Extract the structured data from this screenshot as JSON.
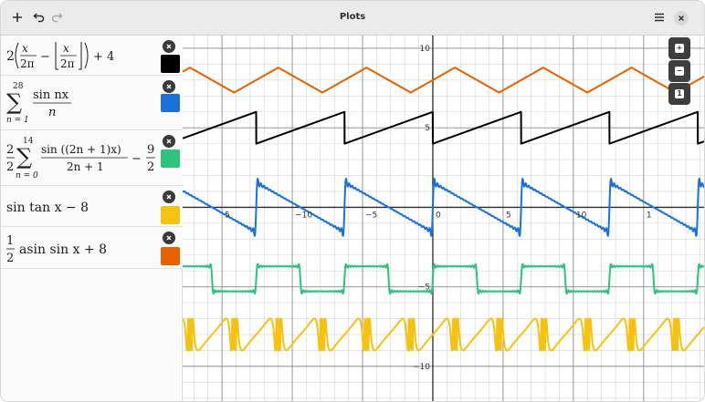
{
  "window": {
    "title": "Plots"
  },
  "header": {
    "left_icons": [
      "add-icon",
      "undo-icon",
      "redo-icon"
    ],
    "right_icons": [
      "menu-icon",
      "close-icon"
    ]
  },
  "equations": [
    {
      "latex": "2\\left(\\frac{x}{2\\pi}-\\left\\lfloor\\frac{x}{2\\pi}\\right\\rfloor\\right)+4",
      "color": "#000000"
    },
    {
      "latex": "\\sum_{n=1}^{28}\\frac{\\sin nx}{n}",
      "color": "#1c71d8"
    },
    {
      "latex": "\\frac{2}{2}\\sum_{n=0}^{14}\\frac{\\sin((2n+1)x)}{2n+1}-\\frac{9}{2}",
      "color": "#2ec27e"
    },
    {
      "latex": "\\sin\\tan x-8",
      "color": "#f5c211"
    },
    {
      "latex": "\\frac{1}{2}\\operatorname{asin}\\sin x+8",
      "color": "#e66100"
    }
  ],
  "eq_text": {
    "e1": {
      "coef": "2",
      "num1": "x",
      "den1": "2π",
      "minus": "−",
      "num2": "x",
      "den2": "2π",
      "tail": "+ 4"
    },
    "e2": {
      "top": "28",
      "bottom": "n = 1",
      "num": "sin nx",
      "den": "n"
    },
    "e3": {
      "frac_num": "2",
      "frac_den": "2",
      "top": "14",
      "bottom": "n = 0",
      "num": "sin ((2n + 1)x)",
      "den": "2n + 1",
      "minus": "−",
      "num2": "9",
      "den2": "2"
    },
    "e4": {
      "text": "sin tan x − 8"
    },
    "e5": {
      "num": "1",
      "den": "2",
      "text": "asin sin x + 8"
    }
  },
  "plot": {
    "x_ticks": [
      "5",
      "−10",
      "−5",
      "0",
      "5",
      "10",
      "1"
    ],
    "y_ticks": [
      "10",
      "5",
      "−5",
      "−10"
    ],
    "zoom_icons": [
      "zoom-in-icon",
      "zoom-out-icon",
      "zoom-reset-icon"
    ],
    "zoom_glyphs": [
      "+",
      "−",
      "1"
    ]
  },
  "chart_data": {
    "type": "line",
    "xlim": [
      -17.8,
      19.3
    ],
    "ylim": [
      -12.3,
      10.8
    ],
    "grid": true,
    "series": [
      {
        "expression": "2(x/2π − ⌊x/2π⌋) + 4",
        "color": "#000000"
      },
      {
        "expression": "Σ_{n=1}^{28} sin nx / n",
        "color": "#1c71d8"
      },
      {
        "expression": "(2/2) Σ_{n=0}^{14} sin((2n+1)x)/(2n+1) − 9/2",
        "color": "#2ec27e"
      },
      {
        "expression": "sin tan x − 8",
        "color": "#f5c211"
      },
      {
        "expression": "(1/2) asin sin x + 8",
        "color": "#e66100"
      }
    ]
  }
}
